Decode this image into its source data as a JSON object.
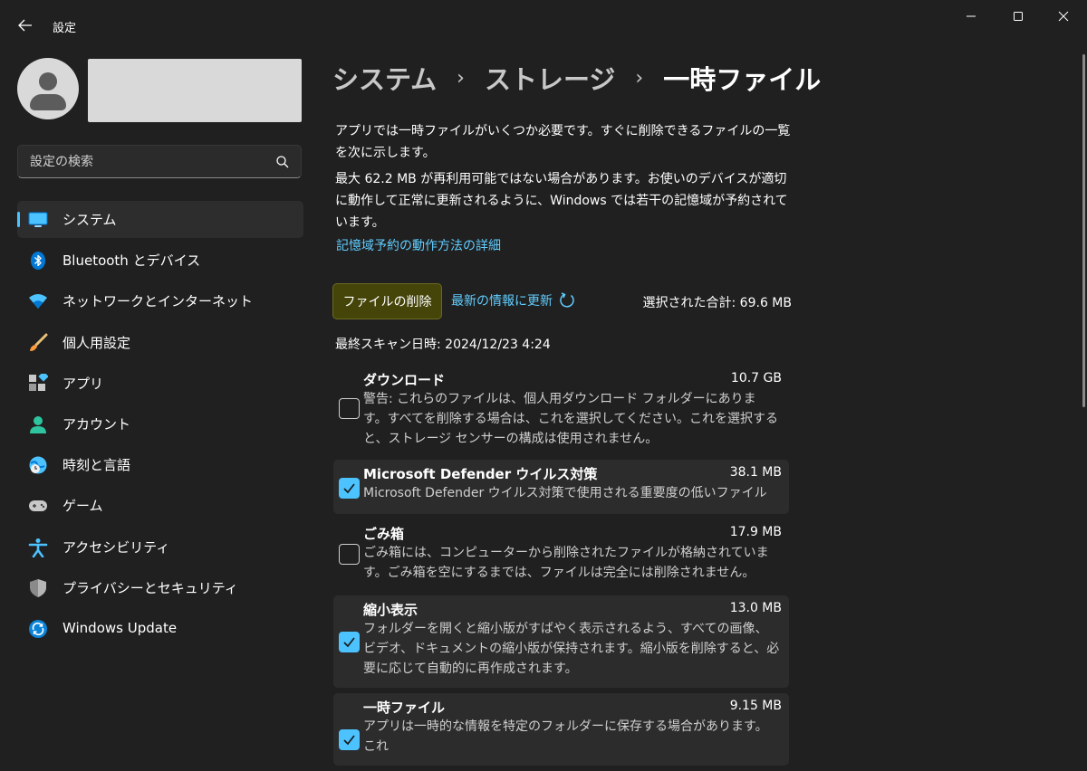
{
  "window": {
    "title": "設定",
    "controls": [
      "minimize-icon",
      "maximize-icon",
      "close-icon"
    ]
  },
  "sidebar": {
    "search_placeholder": "設定の検索",
    "items": [
      {
        "label": "システム",
        "icon": "system-icon",
        "active": true
      },
      {
        "label": "Bluetooth とデバイス",
        "icon": "bluetooth-icon"
      },
      {
        "label": "ネットワークとインターネット",
        "icon": "wifi-icon"
      },
      {
        "label": "個人用設定",
        "icon": "brush-icon"
      },
      {
        "label": "アプリ",
        "icon": "apps-icon"
      },
      {
        "label": "アカウント",
        "icon": "account-icon"
      },
      {
        "label": "時刻と言語",
        "icon": "time-language-icon"
      },
      {
        "label": "ゲーム",
        "icon": "gamepad-icon"
      },
      {
        "label": "アクセシビリティ",
        "icon": "accessibility-icon"
      },
      {
        "label": "プライバシーとセキュリティ",
        "icon": "shield-icon"
      },
      {
        "label": "Windows Update",
        "icon": "update-icon"
      }
    ]
  },
  "breadcrumb": {
    "items": [
      "システム",
      "ストレージ"
    ],
    "current": "一時ファイル",
    "separator": "›"
  },
  "main": {
    "desc1": "アプリでは一時ファイルがいくつか必要です。すぐに削除できるファイルの一覧を次に示します。",
    "desc2": "最大 62.2 MB が再利用可能ではない場合があります。お使いのデバイスが適切に動作して正常に更新されるように、Windows では若干の記憶域が予約されています。",
    "link": "記憶域予約の動作方法の詳細",
    "delete_button": "ファイルの削除",
    "refresh_label": "最新の情報に更新",
    "selected_total": "選択された合計: 69.6 MB",
    "last_scan": "最終スキャン日時: 2024/12/23 4:24"
  },
  "files": [
    {
      "name": "ダウンロード",
      "size": "10.7 GB",
      "checked": false,
      "desc": "警告: これらのファイルは、個人用ダウンロード フォルダーにあります。すべてを削除する場合は、これを選択してください。これを選択すると、ストレージ センサーの構成は使用されません。"
    },
    {
      "name": "Microsoft Defender ウイルス対策",
      "size": "38.1 MB",
      "checked": true,
      "desc": "Microsoft Defender ウイルス対策で使用される重要度の低いファイル"
    },
    {
      "name": "ごみ箱",
      "size": "17.9 MB",
      "checked": false,
      "desc": "ごみ箱には、コンピューターから削除されたファイルが格納されています。ごみ箱を空にするまでは、ファイルは完全には削除されません。"
    },
    {
      "name": "縮小表示",
      "size": "13.0 MB",
      "checked": true,
      "desc": "フォルダーを開くと縮小版がすばやく表示されるよう、すべての画像、ビデオ、ドキュメントの縮小版が保持されます。縮小版を削除すると、必要に応じて自動的に再作成されます。"
    },
    {
      "name": "一時ファイル",
      "size": "9.15 MB",
      "checked": true,
      "desc": "アプリは一時的な情報を特定のフォルダーに保存する場合があります。これ"
    }
  ],
  "colors": {
    "background": "#202020",
    "accent": "#4cc2ff",
    "link": "#60cdff",
    "delete_button": "#45450a"
  }
}
